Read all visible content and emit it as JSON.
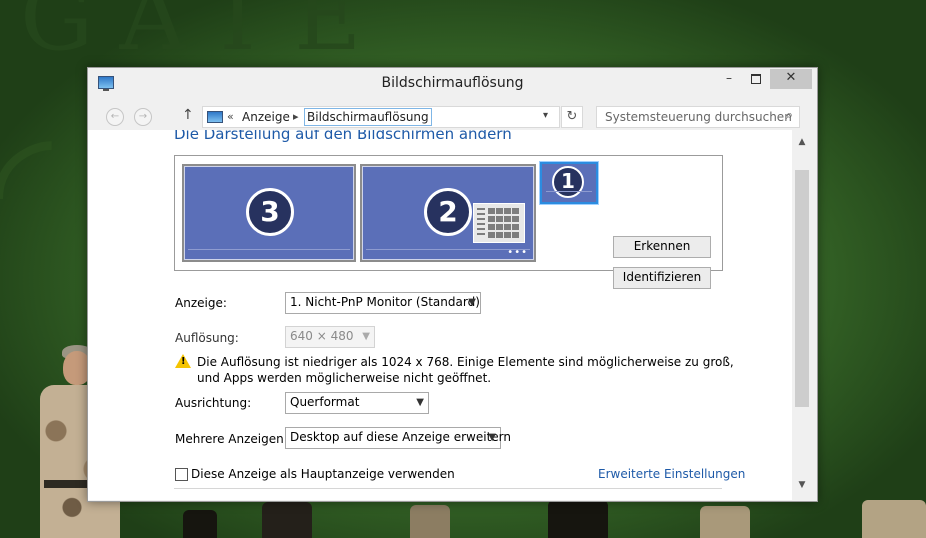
{
  "window": {
    "title": "Bildschirmauflösung",
    "controls": {
      "minimize": "–",
      "close": "✕"
    }
  },
  "navigation": {
    "back": "←",
    "forward": "→",
    "up": "↑",
    "breadcrumb_prefix": "«",
    "breadcrumb": [
      "Anzeige",
      "Bildschirmauflösung"
    ],
    "search_placeholder": "Systemsteuerung durchsuchen"
  },
  "content": {
    "heading": "Die Darstellung auf den Bildschirmen ändern",
    "monitors": [
      {
        "number": "3"
      },
      {
        "number": "2"
      },
      {
        "number": "1",
        "selected": true
      }
    ],
    "buttons": {
      "detect": "Erkennen",
      "identify": "Identifizieren"
    },
    "fields": {
      "display": {
        "label": "Anzeige:",
        "value": "1. Nicht-PnP Monitor (Standard)"
      },
      "resolution": {
        "label": "Auflösung:",
        "value": "640 × 480",
        "disabled": true
      },
      "orientation": {
        "label": "Ausrichtung:",
        "value": "Querformat"
      },
      "multiple": {
        "label": "Mehrere Anzeigen:",
        "value": "Desktop auf diese Anzeige erweitern"
      }
    },
    "warning": "Die Auflösung ist niedriger als 1024 x 768. Einige Elemente sind möglicherweise zu groß, und Apps werden möglicherweise nicht geöffnet.",
    "main_display_checkbox": {
      "label": "Diese Anzeige als Hauptanzeige verwenden",
      "checked": false
    },
    "advanced_link": "Erweiterte Einstellungen"
  },
  "desktop": {
    "wallpaper_text": "GATE"
  },
  "colors": {
    "accent": "#1e5aa8",
    "monitor_fill": "#5b6fb8",
    "selected_border": "#2b8ce0",
    "warning": "#f5c400"
  }
}
